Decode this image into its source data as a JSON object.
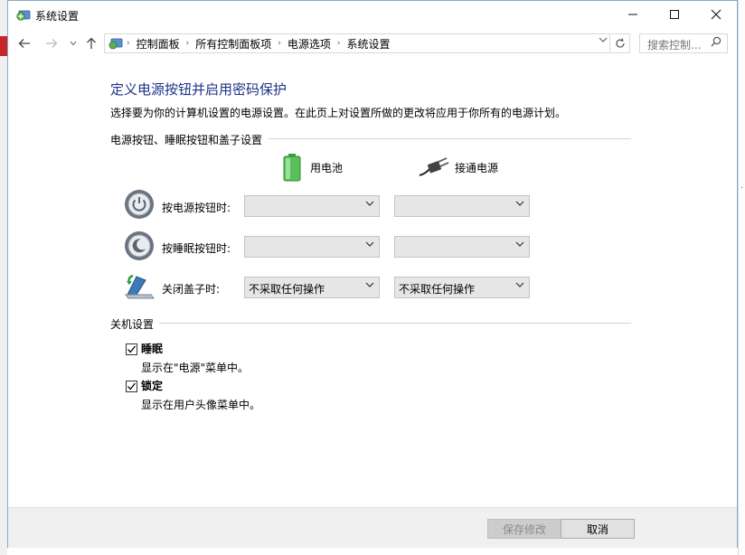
{
  "window": {
    "title": "系统设置",
    "controls": {
      "minimize": "—",
      "maximize": "☐",
      "close": "✕"
    }
  },
  "address_bar": {
    "breadcrumbs": [
      "控制面板",
      "所有控制面板项",
      "电源选项",
      "系统设置"
    ],
    "separator": "›",
    "search_placeholder": "搜索控制..."
  },
  "page": {
    "heading": "定义电源按钮并启用密码保护",
    "description": "选择要为你的计算机设置的电源设置。在此页上对设置所做的更改将应用于你所有的电源计划。"
  },
  "power_buttons_section": {
    "title": "电源按钮、睡眠按钮和盖子设置",
    "columns": {
      "battery": "用电池",
      "plugged_in": "接通电源"
    },
    "rows": [
      {
        "label": "按电源按钮时:",
        "icon": "power-button-icon",
        "battery_value": "",
        "plugged_value": ""
      },
      {
        "label": "按睡眠按钮时:",
        "icon": "sleep-button-icon",
        "battery_value": "",
        "plugged_value": ""
      },
      {
        "label": "关闭盖子时:",
        "icon": "laptop-lid-icon",
        "battery_value": "不采取任何操作",
        "plugged_value": "不采取任何操作"
      }
    ]
  },
  "shutdown_section": {
    "title": "关机设置",
    "options": [
      {
        "label": "睡眠",
        "description": "显示在\"电源\"菜单中。",
        "checked": true
      },
      {
        "label": "锁定",
        "description": "显示在用户头像菜单中。",
        "checked": true
      }
    ]
  },
  "footer": {
    "save_label": "保存修改",
    "cancel_label": "取消",
    "save_disabled": true
  },
  "colors": {
    "heading": "#1e3287",
    "window_border": "#8aa6c8",
    "dropdown_bg": "#e6e6e6"
  }
}
